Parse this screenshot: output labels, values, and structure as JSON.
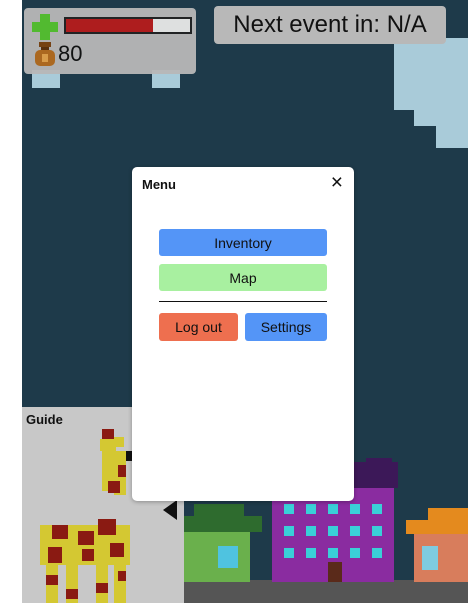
{
  "hud": {
    "health_fraction": 0.7,
    "coins": "80",
    "colors": {
      "health": "#b61c1c",
      "plus": "#55c12f",
      "coin_bag": "#b36b1e"
    }
  },
  "event": {
    "text": "Next event in: N/A"
  },
  "menu": {
    "title": "Menu",
    "close_symbol": "×",
    "inventory_label": "Inventory",
    "map_label": "Map",
    "logout_label": "Log out",
    "settings_label": "Settings",
    "colors": {
      "inventory": "#5495f7",
      "map": "#a8f0a0",
      "logout": "#ee6f4f",
      "settings": "#5495f7"
    }
  },
  "guide": {
    "title": "Guide",
    "icon": "giraffe-sprite"
  }
}
